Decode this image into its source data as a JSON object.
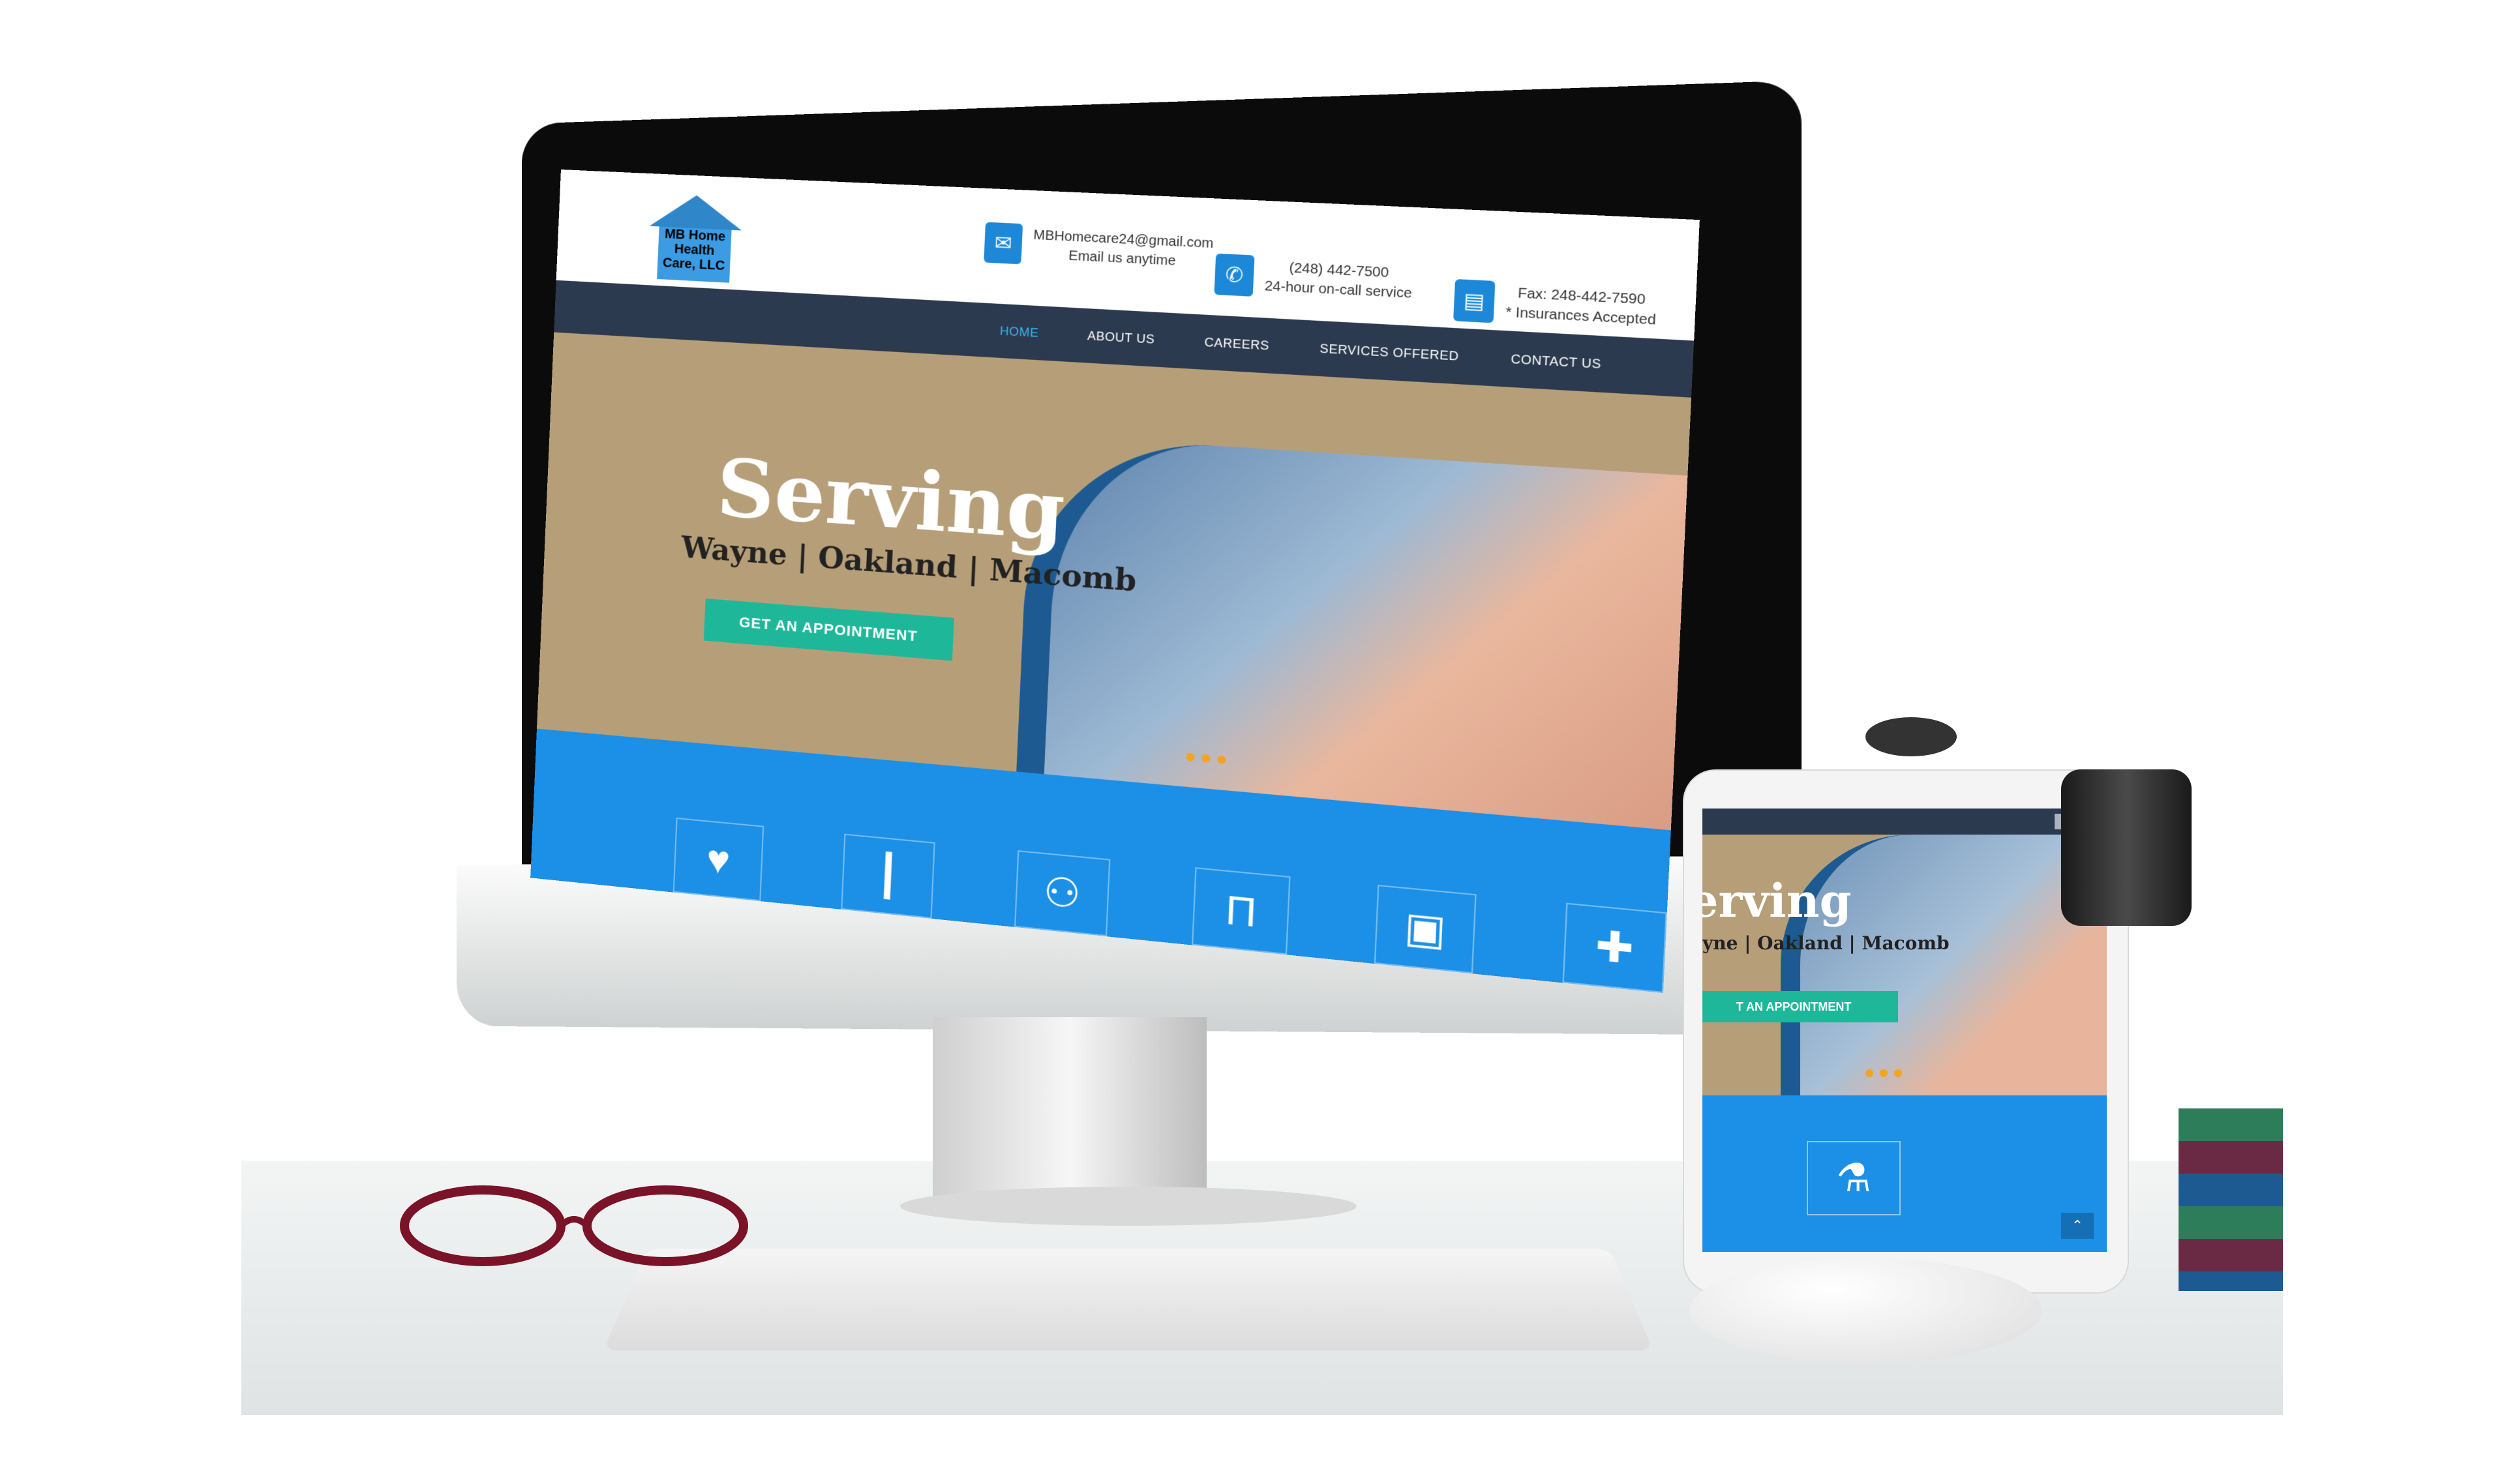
{
  "site": {
    "logo_text": "MB Home Health Care, LLC",
    "email": "MBHomecare24@gmail.com",
    "email_sub": "Email us anytime",
    "phone": "(248) 442-7500",
    "phone_sub": "24-hour on-call service",
    "fax": "Fax: 248-442-7590",
    "fax_sub": "* Insurances Accepted"
  },
  "nav": {
    "items": [
      "HOME",
      "ABOUT US",
      "CAREERS",
      "SERVICES OFFERED",
      "CONTACT US"
    ],
    "active": "HOME"
  },
  "hero": {
    "title": "Serving",
    "subtitle": "Wayne | Oakland | Macomb",
    "cta": "GET AN APPOINTMENT"
  },
  "tablet": {
    "title": "erving",
    "subtitle": "yne | Oakland | Macomb",
    "cta": "T AN APPOINTMENT"
  },
  "icons": [
    "heart-icon",
    "cane-icon",
    "family-icon",
    "pill-icon",
    "briefcase-icon",
    "hospital-icon",
    "flask-icon",
    "up-arrow-icon"
  ],
  "colors": {
    "nav_bg": "#2b3a4e",
    "accent_blue": "#1c8fe6",
    "cta_green": "#1fb79a",
    "hero_tan": "#b69f78",
    "dot_orange": "#f3a421"
  }
}
